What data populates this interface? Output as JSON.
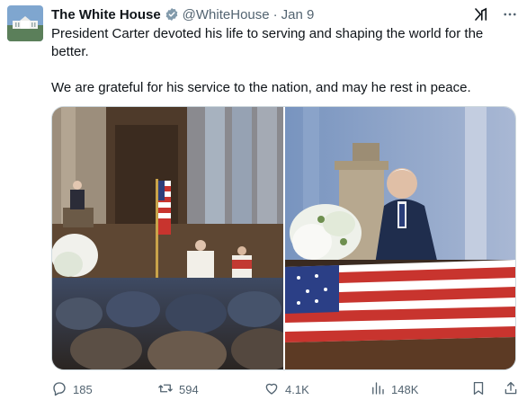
{
  "post": {
    "author_name": "The White House",
    "handle": "@WhiteHouse",
    "separator": "·",
    "time": "Jan 9",
    "text_line1": "President Carter devoted his life to serving and shaping the world for the better.",
    "text_line2": "We are grateful for his service to the nation, and may he rest in peace."
  },
  "actions": {
    "replies": "185",
    "reposts": "594",
    "likes": "4.1K",
    "views": "148K"
  },
  "colors": {
    "verified_badge": "#829aab",
    "secondary_text": "#536471",
    "primary_text": "#0f1419"
  },
  "icons": {
    "verified": "verified-badge-icon",
    "grok": "grok-icon",
    "more": "more-icon",
    "reply": "reply-icon",
    "repost": "repost-icon",
    "like": "like-icon",
    "views": "views-icon",
    "bookmark": "bookmark-icon",
    "share": "share-icon"
  }
}
